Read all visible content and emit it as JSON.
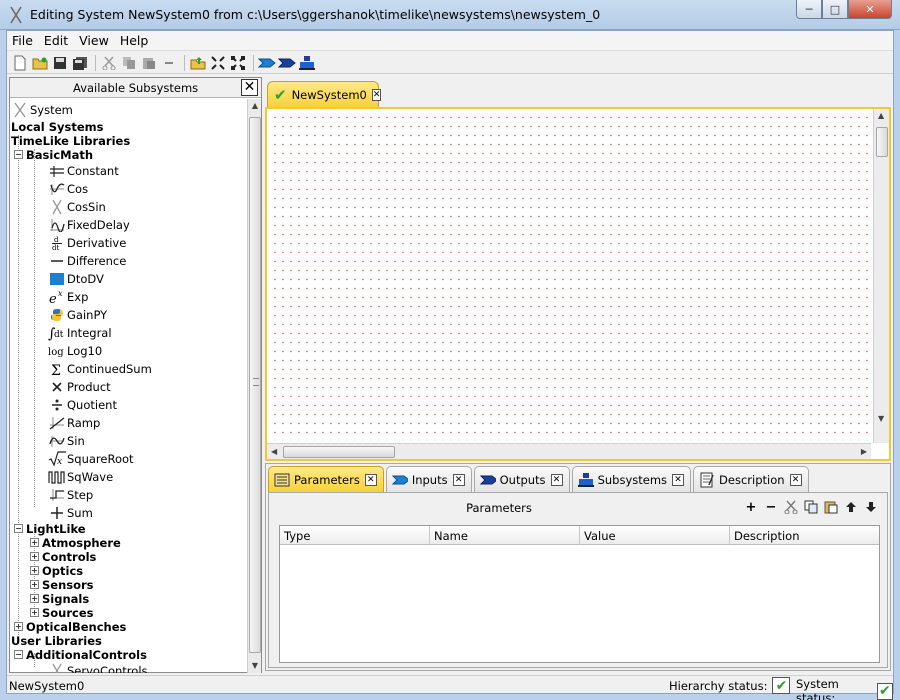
{
  "window": {
    "title": "Editing System NewSystem0 from c:\\Users\\ggershanok\\timelike\\newsystems\\newsystem_0",
    "minimize": "─",
    "maximize": "□",
    "close": "✕"
  },
  "menu": [
    "File",
    "Edit",
    "View",
    "Help"
  ],
  "left_panel": {
    "title": "Available Subsystems",
    "close": "✕",
    "tree": {
      "system": "System",
      "local_systems": "Local Systems",
      "timelike_libraries": "TimeLike Libraries",
      "basic_math": "BasicMath",
      "basic_math_items": [
        "Constant",
        "Cos",
        "CosSin",
        "FixedDelay",
        "Derivative",
        "Difference",
        "DtoDV",
        "Exp",
        "GainPY",
        "Integral",
        "Log10",
        "ContinuedSum",
        "Product",
        "Quotient",
        "Ramp",
        "Sin",
        "SquareRoot",
        "SqWave",
        "Step",
        "Sum"
      ],
      "lightlike": "LightLike",
      "lightlike_items": [
        "Atmosphere",
        "Controls",
        "Optics",
        "Sensors",
        "Signals",
        "Sources"
      ],
      "optical_benches": "OpticalBenches",
      "user_libraries": "User Libraries",
      "additional_controls": "AdditionalControls",
      "servo_controls": "ServoControls"
    }
  },
  "editor": {
    "tab_label": "NewSystem0",
    "tab_close": "✕"
  },
  "bottom": {
    "tabs": [
      {
        "label": "Parameters",
        "active": true
      },
      {
        "label": "Inputs",
        "active": false
      },
      {
        "label": "Outputs",
        "active": false
      },
      {
        "label": "Subsystems",
        "active": false
      },
      {
        "label": "Description",
        "active": false
      }
    ],
    "tab_close": "✕",
    "panel_title": "Parameters",
    "columns": [
      "Type",
      "Name",
      "Value",
      "Description"
    ]
  },
  "status": {
    "left": "NewSystem0",
    "hierarchy_label": "Hierarchy status:",
    "system_label": "System status:",
    "ok_mark": "✔"
  },
  "colors": {
    "active_tab": "#f7d23a",
    "grid_dot": "#e05050",
    "ok_green": "#2aa02a"
  }
}
